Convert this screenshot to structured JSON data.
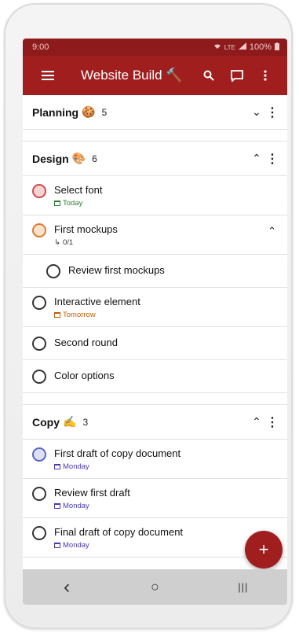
{
  "status": {
    "time": "9:00",
    "network": "LTE",
    "battery": "100%"
  },
  "appbar": {
    "title": "Website Build 🔨"
  },
  "sections": [
    {
      "name": "Planning",
      "emoji": "🍪",
      "count": "5",
      "chevron": "⌄"
    },
    {
      "name": "Design",
      "emoji": "🎨",
      "count": "6",
      "chevron": "⌃"
    },
    {
      "name": "Copy",
      "emoji": "✍",
      "count": "3",
      "chevron": "⌃"
    }
  ],
  "design_tasks": [
    {
      "title": "Select font",
      "meta": "Today"
    },
    {
      "title": "First mockups",
      "meta": "0/1"
    },
    {
      "title": "Review first mockups"
    },
    {
      "title": "Interactive element",
      "meta": "Tomorrow"
    },
    {
      "title": "Second round"
    },
    {
      "title": "Color options"
    }
  ],
  "copy_tasks": [
    {
      "title": "First draft of copy document",
      "meta": "Monday"
    },
    {
      "title": "Review first draft",
      "meta": "Monday"
    },
    {
      "title": "Final draft of copy document",
      "meta": "Monday"
    }
  ],
  "fab": {
    "label": "+"
  },
  "navbar": {
    "back": "‹",
    "home": "○",
    "recents": "|||"
  },
  "colors": {
    "primary": "#a01e1e",
    "statusbar": "#8e1b1b"
  }
}
